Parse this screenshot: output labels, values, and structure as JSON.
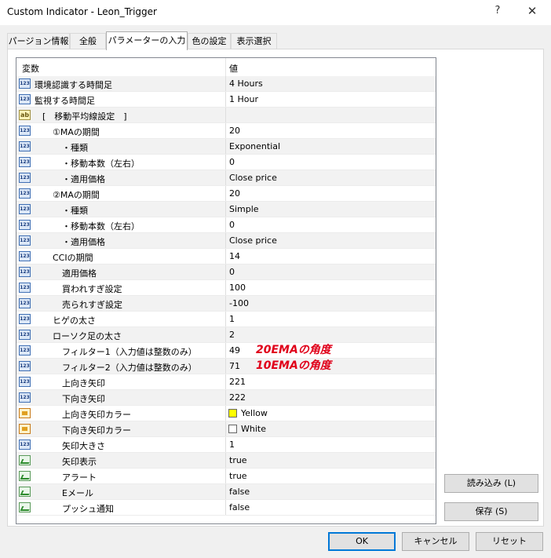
{
  "window": {
    "title": "Custom Indicator - Leon_Trigger",
    "help_glyph": "?",
    "close_glyph": "✕"
  },
  "tabs": [
    {
      "label": "パージョン情報"
    },
    {
      "label": "全般"
    },
    {
      "label": "パラメーターの入力"
    },
    {
      "label": "色の設定"
    },
    {
      "label": "表示選択"
    }
  ],
  "grid": {
    "header": {
      "variable": "変数",
      "value": "値"
    },
    "rows": [
      {
        "icon": "num",
        "label": "環境認識する時間足",
        "value": "4 Hours"
      },
      {
        "icon": "num",
        "label": "監視する時間足",
        "value": "1 Hour"
      },
      {
        "icon": "str",
        "label": "[　移動平均線設定　]",
        "value": ""
      },
      {
        "icon": "num",
        "label": "①MAの期間",
        "value": "20"
      },
      {
        "icon": "num",
        "label": "・種類",
        "value": "Exponential"
      },
      {
        "icon": "num",
        "label": "・移動本数（左右）",
        "value": "0"
      },
      {
        "icon": "num",
        "label": "・適用価格",
        "value": "Close price"
      },
      {
        "icon": "num",
        "label": "②MAの期間",
        "value": "20"
      },
      {
        "icon": "num",
        "label": "・種類",
        "value": "Simple"
      },
      {
        "icon": "num",
        "label": "・移動本数（左右）",
        "value": "0"
      },
      {
        "icon": "num",
        "label": "・適用価格",
        "value": "Close price"
      },
      {
        "icon": "num",
        "label": "CCIの期間",
        "value": "14"
      },
      {
        "icon": "num",
        "label": "適用価格",
        "value": "0"
      },
      {
        "icon": "num",
        "label": "買われすぎ設定",
        "value": "100"
      },
      {
        "icon": "num",
        "label": "売られすぎ設定",
        "value": "-100"
      },
      {
        "icon": "num",
        "label": "ヒゲの太さ",
        "value": "1"
      },
      {
        "icon": "num",
        "label": "ローソク足の太さ",
        "value": "2"
      },
      {
        "icon": "num",
        "label": "フィルター1（入力値は整数のみ）",
        "value": "49"
      },
      {
        "icon": "num",
        "label": "フィルター2（入力値は整数のみ）",
        "value": "71"
      },
      {
        "icon": "num",
        "label": "上向き矢印",
        "value": "221"
      },
      {
        "icon": "num",
        "label": "下向き矢印",
        "value": "222"
      },
      {
        "icon": "color",
        "label": "上向き矢印カラー",
        "value": "Yellow",
        "swatch": "#ffff00"
      },
      {
        "icon": "color",
        "label": "下向き矢印カラー",
        "value": "White",
        "swatch": "#ffffff"
      },
      {
        "icon": "num",
        "label": "矢印大きさ",
        "value": "1"
      },
      {
        "icon": "bool",
        "label": "矢印表示",
        "value": "true"
      },
      {
        "icon": "bool",
        "label": "アラート",
        "value": "true"
      },
      {
        "icon": "bool",
        "label": "Eメール",
        "value": "false"
      },
      {
        "icon": "bool",
        "label": "プッシュ通知",
        "value": "false"
      }
    ]
  },
  "annotations": [
    {
      "text": "20EMAの角度",
      "color": "#e0001a"
    },
    {
      "text": "10EMAの角度",
      "color": "#e0001a"
    }
  ],
  "buttons": {
    "load": "読み込み (L)",
    "save": "保存 (S)",
    "ok": "OK",
    "cancel": "キャンセル",
    "reset": "リセット"
  }
}
